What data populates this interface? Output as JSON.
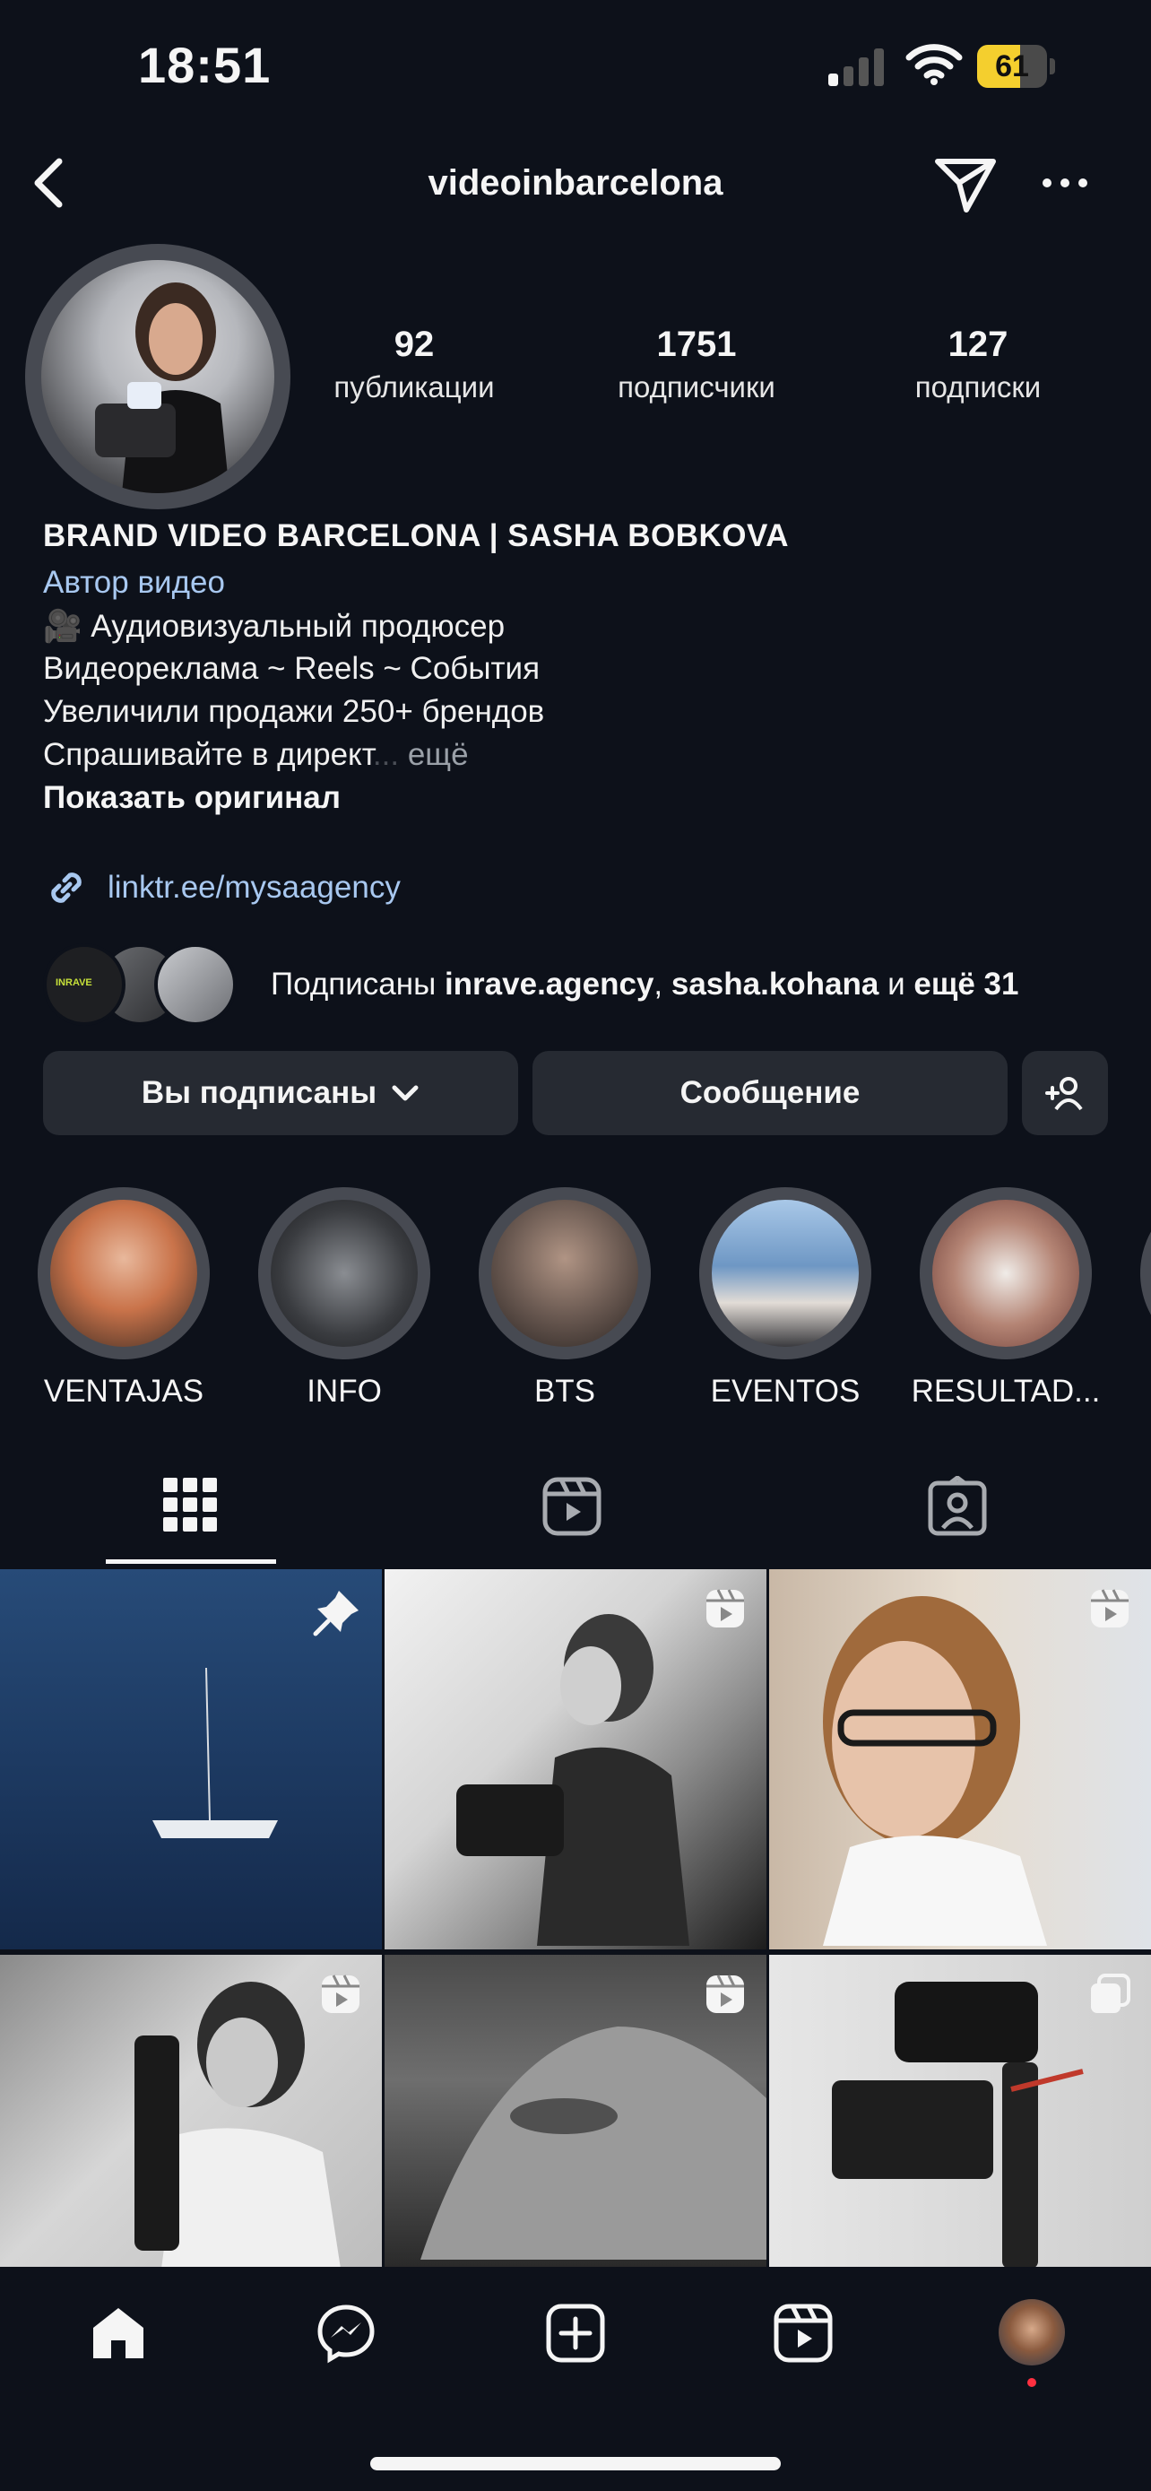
{
  "status_bar": {
    "time": "18:51",
    "battery": "61",
    "battery_level": 0.61
  },
  "header": {
    "username": "videoinbarcelona"
  },
  "profile": {
    "stats": [
      {
        "value": "92",
        "label": "публикации"
      },
      {
        "value": "1751",
        "label": "подписчики"
      },
      {
        "value": "127",
        "label": "подписки"
      }
    ],
    "name": "BRAND VIDEO BARCELONA | SASHA BOBKOVA",
    "category": "Автор видео",
    "bio_lines": [
      "🎥 Аудиовизуальный продюсер",
      "Видеореклама ~ Reels ~ События",
      "Увеличили продажи 250+ брендов",
      "Спрашивайте в директ"
    ],
    "bio_ellipsis": "...",
    "bio_more": "ещё",
    "show_original": "Показать оригинал",
    "link": "linktr.ee/mysaagency",
    "followed_by": {
      "prefix": "Подписаны ",
      "user1": "inrave.agency",
      "sep": ", ",
      "user2": "sasha.kohana",
      "mid": " и ",
      "rest": "ещё 31",
      "mini_avatar_text": "INRAVE"
    }
  },
  "buttons": {
    "following": "Вы подписаны",
    "message": "Сообщение"
  },
  "highlights": [
    "VENTAJAS",
    "INFO",
    "BTS",
    "EVENTOS",
    "RESULTAD..."
  ],
  "colors": {
    "background": "#0d111a",
    "link": "#a8c8f0",
    "button": "#262a32",
    "ring": "#474a52",
    "notification_dot": "#ff3040"
  },
  "icons": {
    "header": [
      "back-icon",
      "send-icon",
      "more-icon"
    ],
    "tabs": [
      "grid-icon",
      "reels-icon",
      "tagged-icon"
    ],
    "nav": [
      "home-icon",
      "messenger-icon",
      "create-icon",
      "reels-icon",
      "profile-avatar"
    ],
    "post_badges": [
      "pin-icon",
      "reel-icon",
      "reel-icon",
      "reel-icon",
      "reel-icon",
      "carousel-icon"
    ]
  }
}
